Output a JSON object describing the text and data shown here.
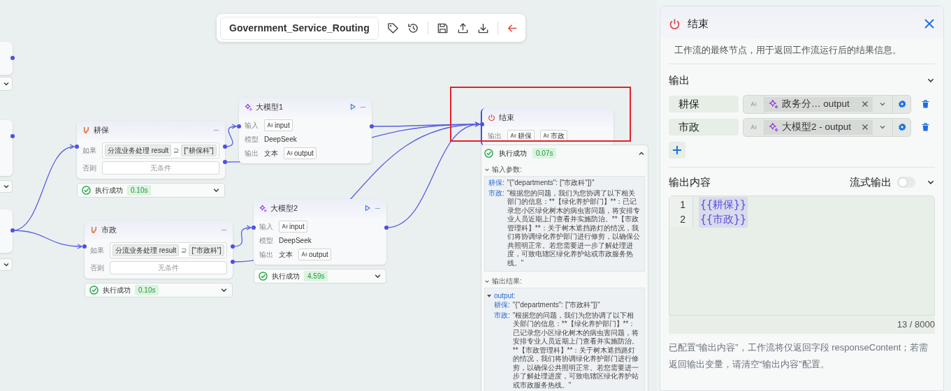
{
  "toolbar": {
    "title": "Government_Service_Routing"
  },
  "canvas": {
    "partial_nodes": [
      {
        "expanded": false
      },
      {
        "expanded": false
      },
      {
        "expanded": false
      }
    ],
    "branches": [
      {
        "title": "耕保",
        "condition_label": "如果",
        "variable": "分流业务处理 result",
        "operator": "⊇",
        "value": "[\"耕保科\"]",
        "else_label": "否则",
        "else_value": "无条件",
        "status": {
          "text": "执行成功",
          "time": "0.10s",
          "expanded": false
        }
      },
      {
        "title": "市政",
        "condition_label": "如果",
        "variable": "分流业务处理 result",
        "operator": "⊇",
        "value": "[\"市政科\"]",
        "else_label": "否则",
        "else_value": "无条件",
        "status": {
          "text": "执行成功",
          "time": "0.10s",
          "expanded": false
        }
      }
    ],
    "models": [
      {
        "title": "大模型1",
        "fields": [
          {
            "label": "输入",
            "kind": "tag",
            "value": "input"
          },
          {
            "label": "模型",
            "kind": "plain",
            "value": "DeepSeek"
          },
          {
            "label": "输出",
            "kind": "typed",
            "type": "文本",
            "value": "output"
          }
        ]
      },
      {
        "title": "大模型2",
        "fields": [
          {
            "label": "输入",
            "kind": "tag",
            "value": "input"
          },
          {
            "label": "模型",
            "kind": "plain",
            "value": "DeepSeek"
          },
          {
            "label": "输出",
            "kind": "typed",
            "type": "文本",
            "value": "output"
          }
        ],
        "status": {
          "text": "执行成功",
          "time": "4.59s",
          "expanded": false
        }
      }
    ],
    "end": {
      "title": "结束",
      "output_label": "输出",
      "outputs": [
        "耕保",
        "市政"
      ],
      "highlighted": true,
      "status": {
        "text": "执行成功",
        "time": "0.07s",
        "expanded": true
      },
      "sections": [
        {
          "title": "输入参数:",
          "expanded": true,
          "entries": [
            {
              "key": "耕保:",
              "value": "\"{\"departments\": [\"市政科\"]}\""
            },
            {
              "key": "市政:",
              "value": "\"根据您的问题，我们为您协调了以下相关部门的信息：**【绿化养护部门】**：已记录您小区绿化树木的病虫害问题，将安排专业人员近期上门查看并实施防治。**【市政管理科】**：关于树木遮挡路灯的情况，我们将协调绿化养护部门进行修剪，以确保公共照明正常。若您需要进一步了解处理进度，可致电辖区绿化养护站或市政服务热线。\""
            }
          ]
        },
        {
          "title": "输出结果:",
          "expanded": true,
          "root": "output:",
          "entries": [
            {
              "key": "耕保:",
              "value": "\"{\"departments\": [\"市政科\"]}\""
            },
            {
              "key": "市政:",
              "value": "\"根据您的问题，我们为您协调了以下相关部门的信息：**【绿化养护部门】**：已记录您小区绿化树木的病虫害问题，将安排专业人员近期上门查看并实施防治。**【市政管理科】**：关于树木遮挡路灯的情况，我们将协调绿化养护部门进行修剪，以确保公共照明正常。若您需要进一步了解处理进度，可致电辖区绿化养护站或市政服务热线。\""
            }
          ]
        }
      ]
    }
  },
  "panel": {
    "title": "结束",
    "description": "工作流的最终节点，用于返回工作流运行后的结果信息。",
    "outputs_section": {
      "title": "输出",
      "expanded": true,
      "rows": [
        {
          "name": "耕保",
          "ref": "政务分…  output"
        },
        {
          "name": "市政",
          "ref": "大模型2 - output"
        }
      ]
    },
    "content_section": {
      "title": "输出内容",
      "stream_label": "流式输出",
      "stream_on": false,
      "expanded": true,
      "lines": [
        {
          "number": "1",
          "text": "{{耕保}}"
        },
        {
          "number": "2",
          "text": "{{市政}}"
        }
      ],
      "counter": "13 / 8000"
    },
    "note": "已配置“输出内容”，工作流将仅返回字段 responseContent；若需返回输出变量，请清空“输出内容”配置。"
  }
}
